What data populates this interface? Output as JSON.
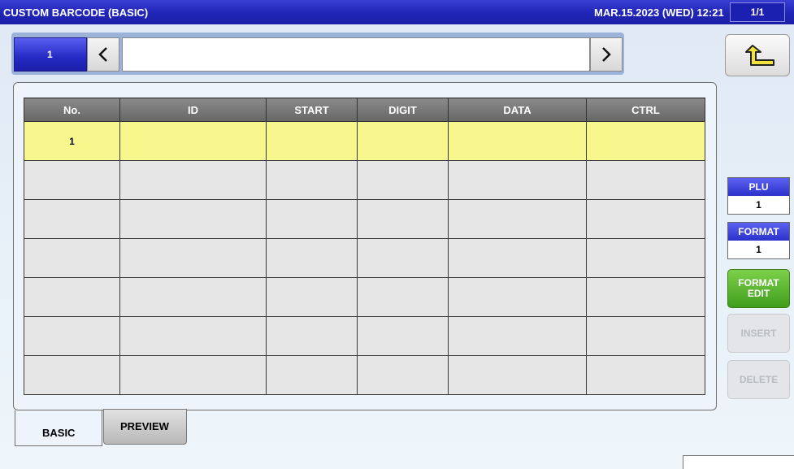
{
  "titlebar": {
    "title": "CUSTOM BARCODE (BASIC)",
    "datetime": "MAR.15.2023 (WED) 12:21",
    "page": "1/1"
  },
  "nav": {
    "number": "1",
    "prev_icon": "chevron-left-icon",
    "next_icon": "chevron-right-icon",
    "back_icon": "return-arrow-icon"
  },
  "table": {
    "headers": [
      "No.",
      "ID",
      "START",
      "DIGIT",
      "DATA",
      "CTRL"
    ],
    "rows": [
      [
        "1",
        "",
        "",
        "",
        "",
        ""
      ],
      [
        "",
        "",
        "",
        "",
        "",
        ""
      ],
      [
        "",
        "",
        "",
        "",
        "",
        ""
      ],
      [
        "",
        "",
        "",
        "",
        "",
        ""
      ],
      [
        "",
        "",
        "",
        "",
        "",
        ""
      ],
      [
        "",
        "",
        "",
        "",
        "",
        ""
      ],
      [
        "",
        "",
        "",
        "",
        "",
        ""
      ]
    ]
  },
  "tabs": {
    "basic": "BASIC",
    "preview": "PREVIEW"
  },
  "side": {
    "plu_label": "PLU",
    "plu_value": "1",
    "format_label": "FORMAT",
    "format_value": "1",
    "format_edit_line1": "FORMAT",
    "format_edit_line2": "EDIT",
    "insert": "INSERT",
    "delete": "DELETE"
  },
  "colors": {
    "title_bar": "#2226b8",
    "selected_row": "#f7f78d",
    "format_edit": "#4fae2a"
  }
}
